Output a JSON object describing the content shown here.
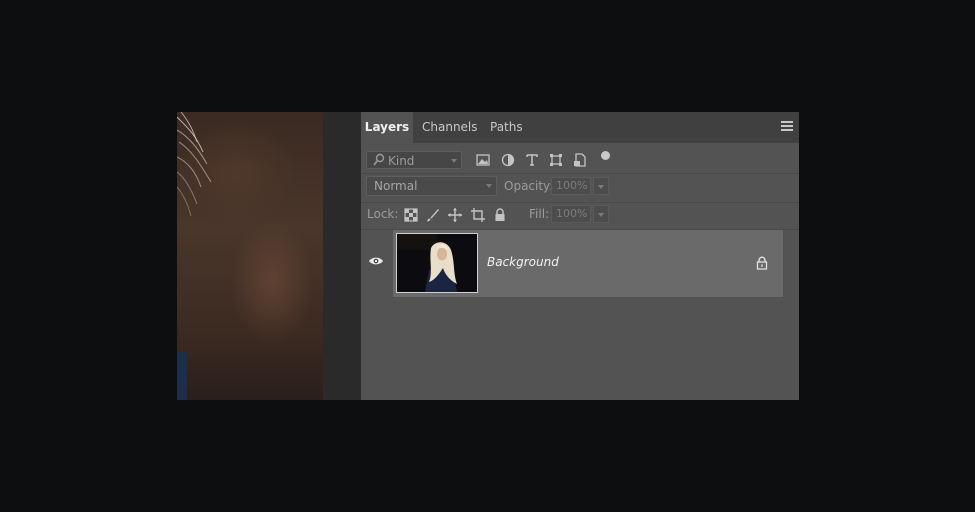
{
  "panel": {
    "tabs": [
      {
        "label": "Layers",
        "active": true
      },
      {
        "label": "Channels",
        "active": false
      },
      {
        "label": "Paths",
        "active": false
      }
    ],
    "menu_icon": "hamburger-icon"
  },
  "filter": {
    "kind_label": "Kind",
    "icons": [
      "image-filter-icon",
      "adjustment-filter-icon",
      "type-filter-icon",
      "shape-filter-icon",
      "smart-object-filter-icon"
    ],
    "toggle": "filter-toggle-dot"
  },
  "blend": {
    "mode": "Normal",
    "opacity_label": "Opacity:",
    "opacity_value": "100%"
  },
  "lock": {
    "label": "Lock:",
    "icons": [
      "lock-transparent-pixels-icon",
      "lock-image-pixels-icon",
      "lock-position-icon",
      "lock-artboard-icon",
      "lock-all-icon"
    ],
    "fill_label": "Fill:",
    "fill_value": "100%"
  },
  "layers": [
    {
      "name": "Background",
      "visible": true,
      "locked": true
    }
  ],
  "colors": {
    "panel_bg": "#535353",
    "tab_bar_bg": "#404040",
    "selected_layer_bg": "#6a6a6a"
  }
}
